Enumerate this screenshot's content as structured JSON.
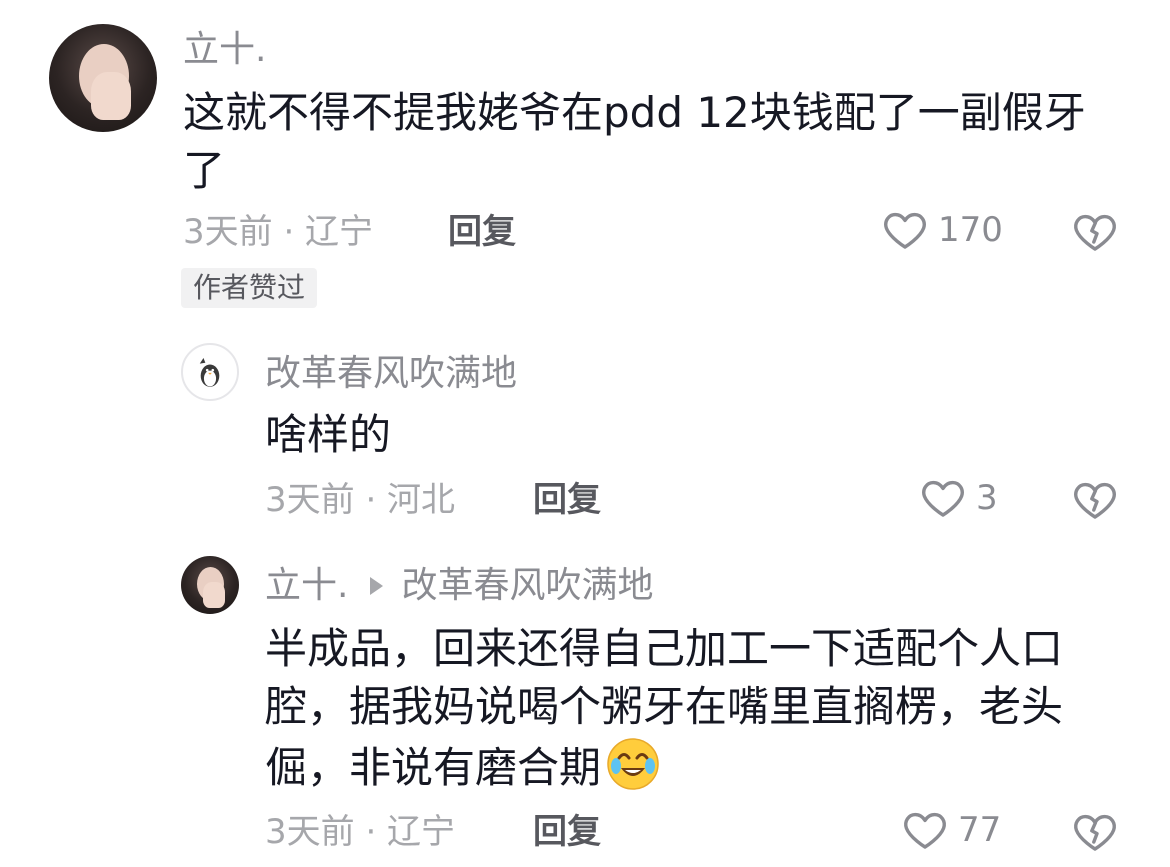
{
  "comments": [
    {
      "username": "立十.",
      "text": "这就不得不提我姥爷在pdd 12块钱配了一副假牙了",
      "time_location": "3天前 · 辽宁",
      "reply_label": "回复",
      "like_count": "170",
      "badge": "作者赞过"
    },
    {
      "username": "改革春风吹满地",
      "text": "啥样的",
      "time_location": "3天前 · 河北",
      "reply_label": "回复",
      "like_count": "3"
    },
    {
      "username": "立十.",
      "reply_to": "改革春风吹满地",
      "text": "半成品，回来还得自己加工一下适配个人口腔，据我妈说喝个粥牙在嘴里直搁楞，老头倔，非说有磨合期",
      "time_location": "3天前 · 辽宁",
      "reply_label": "回复",
      "like_count": "77"
    }
  ],
  "icons": {
    "like": "heart-outline-icon",
    "dislike": "broken-heart-icon",
    "emoji": "crying-laughing-emoji"
  },
  "colors": {
    "text_primary": "#161823",
    "text_secondary": "#8a8b91",
    "text_meta": "#a6a7ab"
  }
}
